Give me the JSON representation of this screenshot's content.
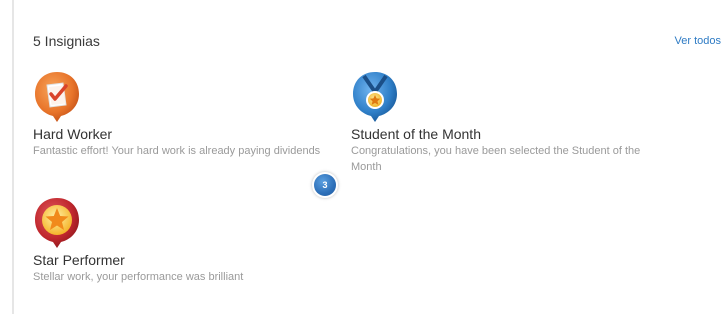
{
  "header": {
    "title": "5 Insignias",
    "see_all_label": "Ver todos"
  },
  "badges": [
    {
      "title": "Hard Worker",
      "description": "Fantastic effort! Your hard work is already paying dividends",
      "icon": "checklist-badge-icon",
      "color": "#e8742a"
    },
    {
      "title": "Student of the Month",
      "description": "Congratulations, you have been selected the Student of the Month",
      "icon": "medal-badge-icon",
      "color": "#2f7fc8"
    },
    {
      "title": "Star Performer",
      "description": "Stellar work, your performance was brilliant",
      "icon": "star-badge-icon",
      "color": "#c0272d"
    }
  ],
  "count_bubble": "3"
}
